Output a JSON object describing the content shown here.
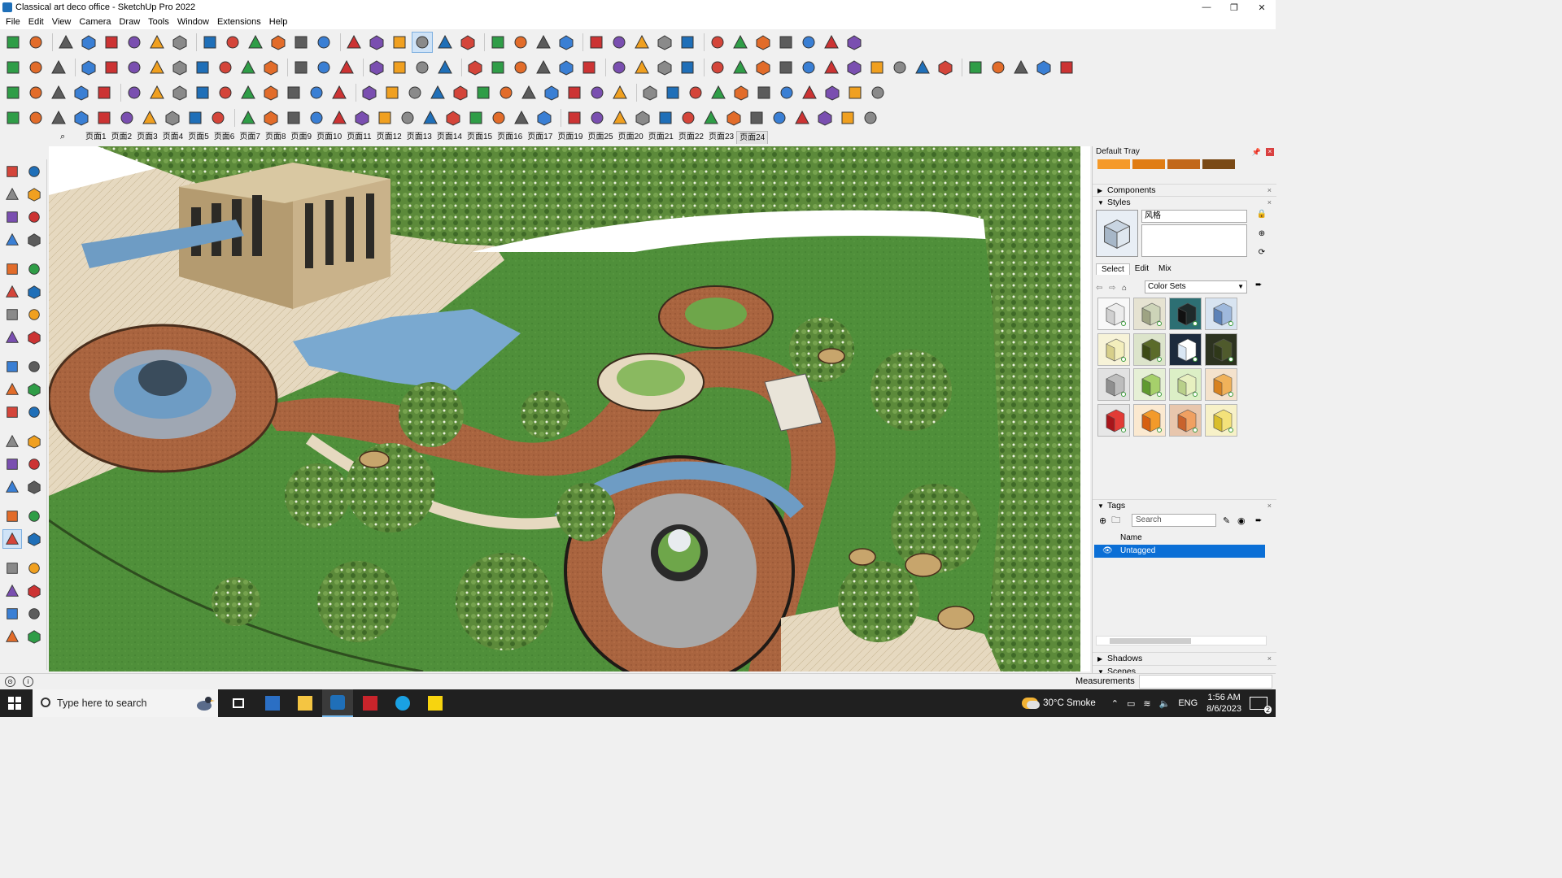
{
  "window": {
    "title": "Classical art deco office - SketchUp Pro 2022",
    "controls": [
      "—",
      "❐",
      "✕"
    ]
  },
  "menu": [
    "File",
    "Edit",
    "View",
    "Camera",
    "Draw",
    "Tools",
    "Window",
    "Extensions",
    "Help"
  ],
  "scene_tabs": [
    "页面1",
    "页面2",
    "页面3",
    "页面4",
    "页面5",
    "页面6",
    "页面7",
    "页面8",
    "页面9",
    "页面10",
    "页面11",
    "页面12",
    "页面13",
    "页面14",
    "页面15",
    "页面16",
    "页面17",
    "页面19",
    "页面25",
    "页面20",
    "页面21",
    "页面22",
    "页面23",
    "页面24"
  ],
  "selected_scene": "页面24",
  "tray": {
    "title": "Default Tray",
    "swatches": [
      "#f59a2a",
      "#e07d15",
      "#c2681a",
      "#7a4a16"
    ],
    "components_label": "Components",
    "styles_label": "Styles",
    "style_name": "风格",
    "style_tabs": [
      "Select",
      "Edit",
      "Mix"
    ],
    "colorsets_label": "Color Sets",
    "style_thumbs": [
      {
        "top": "#ececec",
        "side": "#d0d0d0",
        "bg": "#f8f8f8"
      },
      {
        "top": "#cdd4b8",
        "side": "#9ea383",
        "bg": "#e6e3d2"
      },
      {
        "top": "#1f2a2a",
        "side": "#111",
        "bg": "#2d6f73"
      },
      {
        "top": "#9fb9dc",
        "side": "#5c82b8",
        "bg": "#d8e4f1"
      },
      {
        "top": "#f3eebc",
        "side": "#d7cf8a",
        "bg": "#f7f3d8"
      },
      {
        "top": "#5b6b2a",
        "side": "#3c4a15",
        "bg": "#dce4cb"
      },
      {
        "top": "#ffffff",
        "side": "#d9e6f4",
        "bg": "#1c2a3d"
      },
      {
        "top": "#4f5a2c",
        "side": "#2f3819",
        "bg": "#2d3320"
      },
      {
        "top": "#bdbdbd",
        "side": "#8f8f8f",
        "bg": "#e2e2e2"
      },
      {
        "top": "#a6d06b",
        "side": "#5f9a2f",
        "bg": "#e6f0d6"
      },
      {
        "top": "#e7f0c0",
        "side": "#b9d08a",
        "bg": "#dcefc6"
      },
      {
        "top": "#f0b25a",
        "side": "#d88220",
        "bg": "#f4e2cc"
      },
      {
        "top": "#e23b36",
        "side": "#a8151a",
        "bg": "#e7e7e7"
      },
      {
        "top": "#f39a2a",
        "side": "#d65f10",
        "bg": "#fbe9d0"
      },
      {
        "top": "#f0a062",
        "side": "#c9622c",
        "bg": "#e8c6ad"
      },
      {
        "top": "#f4e27a",
        "side": "#d9be2b",
        "bg": "#f7f1c8"
      }
    ],
    "tags_label": "Tags",
    "tags_search_placeholder": "Search",
    "tags_col_name": "Name",
    "tags_rows": [
      "Untagged"
    ],
    "shadows_label": "Shadows",
    "scenes_label": "Scenes"
  },
  "status": {
    "measurements_label": "Measurements",
    "measurements_value": ""
  },
  "taskbar": {
    "search_placeholder": "Type here to search",
    "weather": "30°C  Smoke",
    "language": "ENG",
    "time": "1:56 AM",
    "date": "8/6/2023",
    "notifications": "2"
  }
}
